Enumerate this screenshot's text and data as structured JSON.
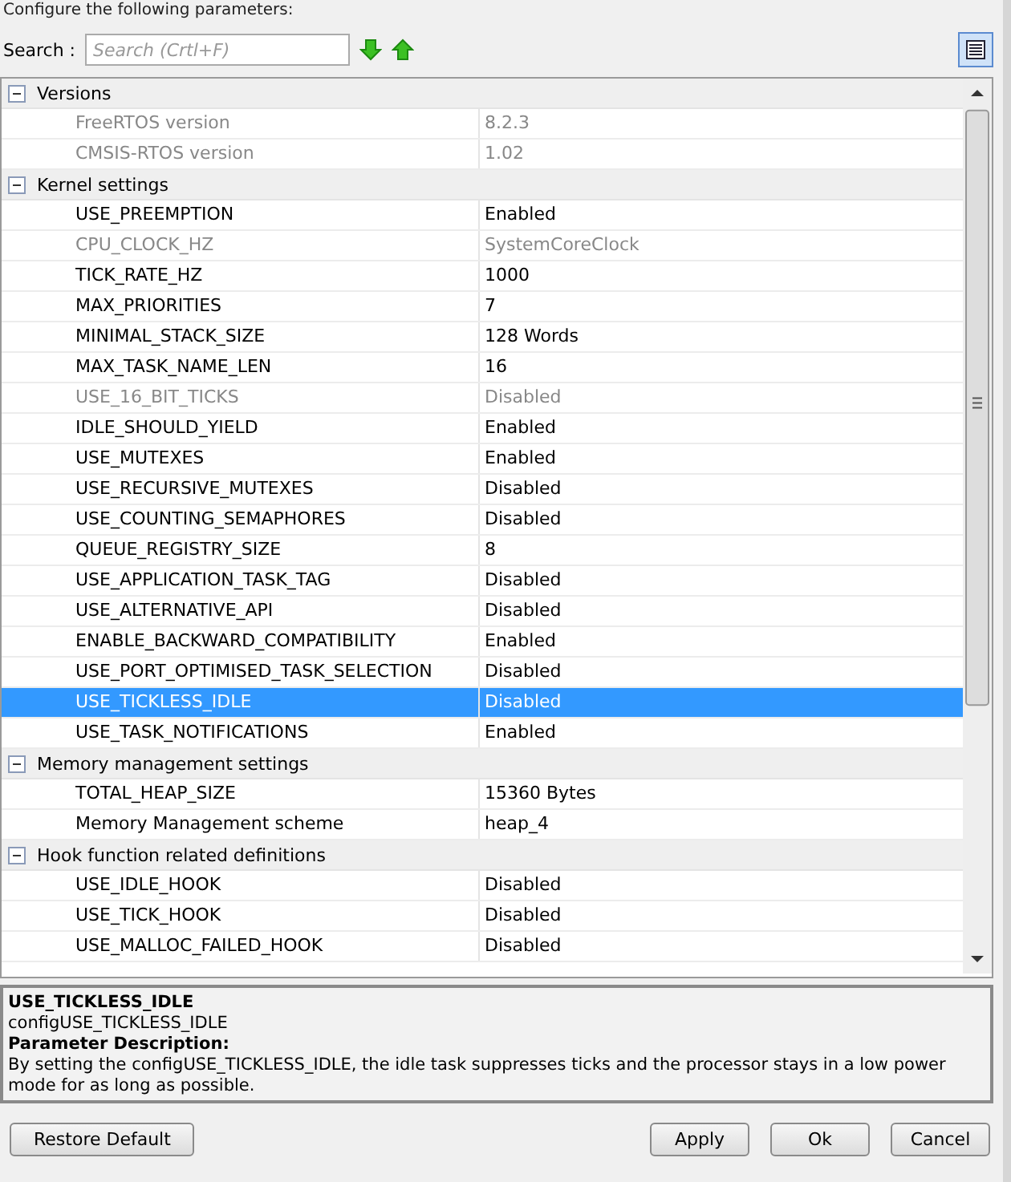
{
  "header": {
    "text": "Configure the following parameters:"
  },
  "search": {
    "label": "Search :",
    "placeholder": "Search (Crtl+F)"
  },
  "groups": [
    {
      "label": "Versions",
      "expanded": true,
      "children": [
        {
          "name": "FreeRTOS version",
          "value": "8.2.3",
          "disabled": true,
          "selected": false
        },
        {
          "name": "CMSIS-RTOS version",
          "value": "1.02",
          "disabled": true,
          "selected": false
        }
      ]
    },
    {
      "label": "Kernel settings",
      "expanded": true,
      "children": [
        {
          "name": "USE_PREEMPTION",
          "value": "Enabled",
          "disabled": false,
          "selected": false
        },
        {
          "name": "CPU_CLOCK_HZ",
          "value": "SystemCoreClock",
          "disabled": true,
          "selected": false
        },
        {
          "name": "TICK_RATE_HZ",
          "value": "1000",
          "disabled": false,
          "selected": false
        },
        {
          "name": "MAX_PRIORITIES",
          "value": "7",
          "disabled": false,
          "selected": false
        },
        {
          "name": "MINIMAL_STACK_SIZE",
          "value": "128 Words",
          "disabled": false,
          "selected": false
        },
        {
          "name": "MAX_TASK_NAME_LEN",
          "value": "16",
          "disabled": false,
          "selected": false
        },
        {
          "name": "USE_16_BIT_TICKS",
          "value": "Disabled",
          "disabled": true,
          "selected": false
        },
        {
          "name": "IDLE_SHOULD_YIELD",
          "value": "Enabled",
          "disabled": false,
          "selected": false
        },
        {
          "name": "USE_MUTEXES",
          "value": "Enabled",
          "disabled": false,
          "selected": false
        },
        {
          "name": "USE_RECURSIVE_MUTEXES",
          "value": "Disabled",
          "disabled": false,
          "selected": false
        },
        {
          "name": "USE_COUNTING_SEMAPHORES",
          "value": "Disabled",
          "disabled": false,
          "selected": false
        },
        {
          "name": "QUEUE_REGISTRY_SIZE",
          "value": "8",
          "disabled": false,
          "selected": false
        },
        {
          "name": "USE_APPLICATION_TASK_TAG",
          "value": "Disabled",
          "disabled": false,
          "selected": false
        },
        {
          "name": "USE_ALTERNATIVE_API",
          "value": "Disabled",
          "disabled": false,
          "selected": false
        },
        {
          "name": "ENABLE_BACKWARD_COMPATIBILITY",
          "value": "Enabled",
          "disabled": false,
          "selected": false
        },
        {
          "name": "USE_PORT_OPTIMISED_TASK_SELECTION",
          "value": "Disabled",
          "disabled": false,
          "selected": false
        },
        {
          "name": "USE_TICKLESS_IDLE",
          "value": "Disabled",
          "disabled": false,
          "selected": true
        },
        {
          "name": "USE_TASK_NOTIFICATIONS",
          "value": "Enabled",
          "disabled": false,
          "selected": false
        }
      ]
    },
    {
      "label": "Memory management settings",
      "expanded": true,
      "children": [
        {
          "name": "TOTAL_HEAP_SIZE",
          "value": "15360 Bytes",
          "disabled": false,
          "selected": false
        },
        {
          "name": "Memory Management scheme",
          "value": "heap_4",
          "disabled": false,
          "selected": false
        }
      ]
    },
    {
      "label": "Hook function related definitions",
      "expanded": true,
      "children": [
        {
          "name": "USE_IDLE_HOOK",
          "value": "Disabled",
          "disabled": false,
          "selected": false
        },
        {
          "name": "USE_TICK_HOOK",
          "value": "Disabled",
          "disabled": false,
          "selected": false
        },
        {
          "name": "USE_MALLOC_FAILED_HOOK",
          "value": "Disabled",
          "disabled": false,
          "selected": false
        }
      ]
    }
  ],
  "description": {
    "title": "USE_TICKLESS_IDLE",
    "config": "configUSE_TICKLESS_IDLE",
    "heading": "Parameter Description:",
    "text": "By setting the configUSE_TICKLESS_IDLE, the idle task suppresses ticks and the processor stays in a low power mode for as long as possible."
  },
  "buttons": {
    "left": "Restore Default",
    "right": [
      "Apply",
      "Ok",
      "Cancel"
    ]
  }
}
